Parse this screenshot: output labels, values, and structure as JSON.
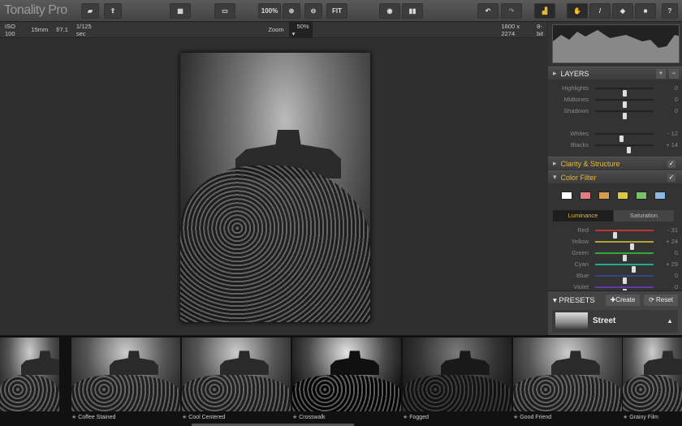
{
  "app": {
    "title": "Tonality Pro"
  },
  "toolbar": {
    "zoom100": "100%",
    "fit": "FIT",
    "help": "?"
  },
  "infobar": {
    "iso": "ISO 100",
    "focal": "15mm",
    "aperture": "f/7.1",
    "shutter": "1/125 sec",
    "zoom_label": "Zoom",
    "zoom_value": "50%",
    "dimensions": "1600 x 2274",
    "bitdepth": "8-bit"
  },
  "layers": {
    "title": "LAYERS",
    "sliders": [
      {
        "label": "Highlights",
        "value": "0",
        "pos": 50
      },
      {
        "label": "Midtones",
        "value": "0",
        "pos": 50
      },
      {
        "label": "Shadows",
        "value": "0",
        "pos": 50
      },
      {
        "label": "Whites",
        "value": "- 12",
        "pos": 44
      },
      {
        "label": "Blacks",
        "value": "+ 14",
        "pos": 57
      }
    ]
  },
  "clarity": {
    "title": "Clarity & Structure"
  },
  "color_filter": {
    "title": "Color Filter",
    "swatches": [
      "#ffffff",
      "#e07d80",
      "#d69a50",
      "#d8c84a",
      "#7dbf6a",
      "#8ab8e0"
    ],
    "tabs": [
      "Luminance",
      "Saturation"
    ],
    "sliders": [
      {
        "label": "Red",
        "value": "- 31",
        "pos": 34,
        "color": "#b33"
      },
      {
        "label": "Yellow",
        "value": "+ 24",
        "pos": 62,
        "color": "#aa3"
      },
      {
        "label": "Green",
        "value": "0",
        "pos": 50,
        "color": "#3a3"
      },
      {
        "label": "Cyan",
        "value": "+ 29",
        "pos": 65,
        "color": "#2a9"
      },
      {
        "label": "Blue",
        "value": "0",
        "pos": 50,
        "color": "#348"
      },
      {
        "label": "Violet",
        "value": "0",
        "pos": 50,
        "color": "#63a"
      }
    ]
  },
  "presets": {
    "title": "PRESETS",
    "create": "Create",
    "reset": "Reset",
    "current": "Street"
  },
  "filmstrip": [
    "Coffee Stained",
    "Cool Centered",
    "Crosswalk",
    "Fogged",
    "Good Friend",
    "Grainy Film"
  ],
  "accent": "#e8b830"
}
